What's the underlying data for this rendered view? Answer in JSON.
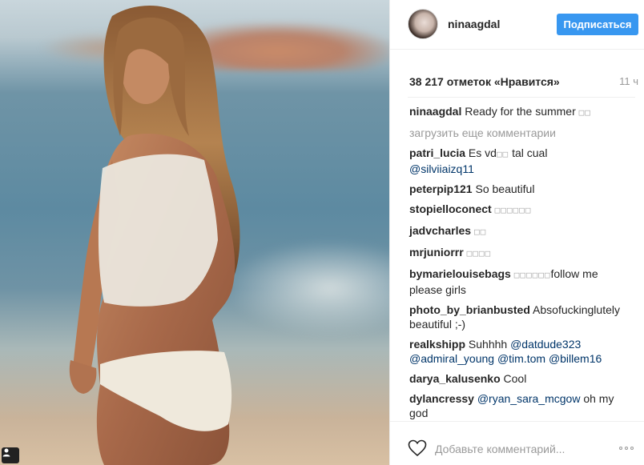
{
  "post": {
    "photo_icon": "person-tag-icon"
  },
  "header": {
    "username": "ninaagdal",
    "follow_label": "Подписаться"
  },
  "stats": {
    "likes": "38 217 отметок «Нравится»",
    "time": "11 ч"
  },
  "caption": {
    "user": "ninaagdal",
    "text": "Ready for the summer",
    "emoji": "□□"
  },
  "load_more": "загрузить еще комментарии",
  "comments": [
    {
      "user": "patri_lucia",
      "text": "Es vd",
      "emoji": "□□",
      "text2": "tal cual",
      "mention": "@silviiaizq11"
    },
    {
      "user": "peterpip121",
      "text": "So beautiful"
    },
    {
      "user": "stopielloconect",
      "emoji": "□□□□□□"
    },
    {
      "user": "jadvcharles",
      "emoji": "□□"
    },
    {
      "user": "mrjuniorrr",
      "emoji": "□□□□"
    },
    {
      "user": "bymarielouisebags",
      "emoji": "□□□□□□",
      "text": "follow me please girls"
    },
    {
      "user": "photo_by_brianbusted",
      "text": "Absofuckinglutely beautiful ;-)"
    },
    {
      "user": "realkshipp",
      "text": "Suhhhh",
      "mentions": [
        "@datdude323",
        "@admiral_young",
        "@tim.tom",
        "@billem16"
      ]
    },
    {
      "user": "darya_kalusenko",
      "text": "Cool"
    },
    {
      "user": "dylancressy",
      "mention": "@ryan_sara_mcgow",
      "text": "oh my god"
    }
  ],
  "footer": {
    "heart_icon": "heart-outline-icon",
    "comment_placeholder": "Добавьте комментарий...",
    "more_icon": "more-options-icon"
  },
  "colors": {
    "follow_button": "#3897f0",
    "mention": "#003569",
    "muted": "#999999"
  }
}
